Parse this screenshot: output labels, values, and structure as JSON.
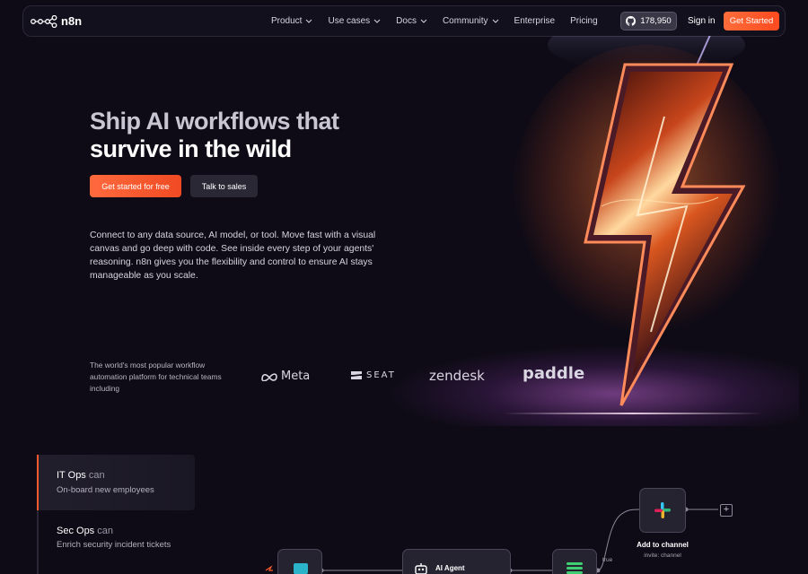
{
  "nav": {
    "logo_text": "n8n",
    "menu": [
      {
        "label": "Product",
        "has_dropdown": true
      },
      {
        "label": "Use cases",
        "has_dropdown": true
      },
      {
        "label": "Docs",
        "has_dropdown": true
      },
      {
        "label": "Community",
        "has_dropdown": true
      },
      {
        "label": "Enterprise",
        "has_dropdown": false
      },
      {
        "label": "Pricing",
        "has_dropdown": false
      }
    ],
    "github_stars": "178,950",
    "github_icon": "github-icon",
    "sign_in": "Sign in",
    "get_started": "Get Started"
  },
  "hero": {
    "title_line1": "Ship AI workflows that",
    "title_line2": "survive in the wild",
    "cta_primary": "Get started for free",
    "cta_secondary": "Talk to sales",
    "description": "Connect to any data source, AI model, or tool. Move fast with a visual canvas and go deep with code. See inside every step of your agents' reasoning. n8n gives you the flexibility and control to ensure AI stays manageable as you scale."
  },
  "trust": {
    "text": "The world's most popular workflow automation platform for technical teams including",
    "brands": [
      "Meta",
      "SEAT",
      "zendesk",
      "paddle"
    ]
  },
  "use_cases": {
    "tabs": [
      {
        "team": "IT Ops",
        "can": "can",
        "task": "On-board new employees",
        "active": true
      },
      {
        "team": "Sec Ops",
        "can": "can",
        "task": "Enrich security incident tickets",
        "active": false
      }
    ]
  },
  "workflow": {
    "nodes": [
      {
        "label": "AI Agent",
        "icon": "robot-icon"
      },
      {
        "label": "Add to channel",
        "sub": "invite: channel",
        "icon": "slack-icon"
      }
    ],
    "branch_label": "true"
  },
  "colors": {
    "background": "#0e0b16",
    "accent": "#ff5a2c",
    "nav_border": "#2c2838"
  }
}
